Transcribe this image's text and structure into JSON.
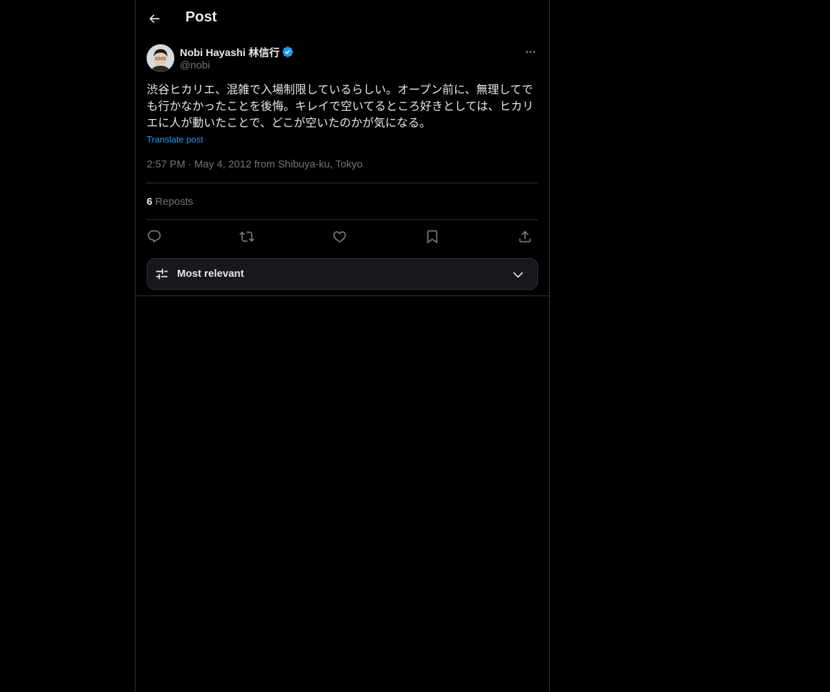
{
  "header": {
    "title": "Post",
    "back_icon": "arrow-left-icon"
  },
  "post": {
    "author": {
      "name": "Nobi Hayashi 林信行",
      "handle": "@nobi",
      "verified": true,
      "verified_color": "#1d9bf0"
    },
    "text": "渋谷ヒカリエ、混雑で入場制限しているらしい。オープン前に、無理してでも行かなかったことを後悔。キレイで空いてるところ好きとしては、ヒカリエに人が動いたことで、どこが空いたのかが気になる。",
    "translate_label": "Translate post",
    "time": "2:57 PM",
    "date": "May 4, 2012",
    "location": "from Shibuya-ku, Tokyo",
    "reposts": {
      "count": "6",
      "label": "Reposts"
    }
  },
  "actions": [
    {
      "name": "reply",
      "icon": "reply-icon"
    },
    {
      "name": "repost",
      "icon": "repost-icon"
    },
    {
      "name": "like",
      "icon": "heart-icon"
    },
    {
      "name": "bookmark",
      "icon": "bookmark-icon"
    },
    {
      "name": "share",
      "icon": "share-icon"
    }
  ],
  "sort": {
    "label": "Most relevant",
    "icon": "sliders-icon",
    "chevron": "chevron-down-icon"
  },
  "colors": {
    "background": "#000000",
    "border": "#2f3336",
    "text_primary": "#e7e9ea",
    "text_secondary": "#71767b",
    "accent": "#1d9bf0"
  }
}
